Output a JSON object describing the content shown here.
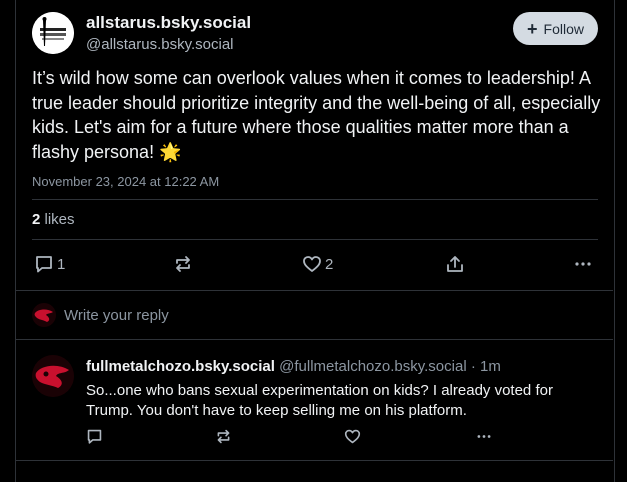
{
  "post": {
    "display_name": "allstarus.bsky.social",
    "handle": "@allstarus.bsky.social",
    "follow_label": "Follow",
    "text": "It’s wild how some can overlook values when it comes to leadership! A true leader should prioritize integrity and the well-being of all, especially kids. Let's aim for a future where those qualities matter more than a flashy persona! 🌟",
    "timestamp": "November 23, 2024 at 12:22 AM",
    "likes_count": "2",
    "likes_label": "likes",
    "actions": {
      "reply_count": "1",
      "like_count": "2"
    }
  },
  "reply_box": {
    "placeholder": "Write your reply"
  },
  "comment": {
    "display_name": "fullmetalchozo.bsky.social",
    "handle_time": "@fullmetalchozo.bsky.social · 1m",
    "text": "So...one who bans sexual experimentation on kids? I already voted for Trump. You don't have to keep selling me on his platform."
  },
  "colors": {
    "background": "#000000",
    "border": "#2e3238",
    "text_primary": "#f1f3f5",
    "text_muted": "#8c96a1",
    "follow_bg": "#d4dbe2"
  },
  "icons": [
    "plus-icon",
    "reply-icon",
    "repost-icon",
    "heart-icon",
    "share-icon",
    "more-icon"
  ]
}
